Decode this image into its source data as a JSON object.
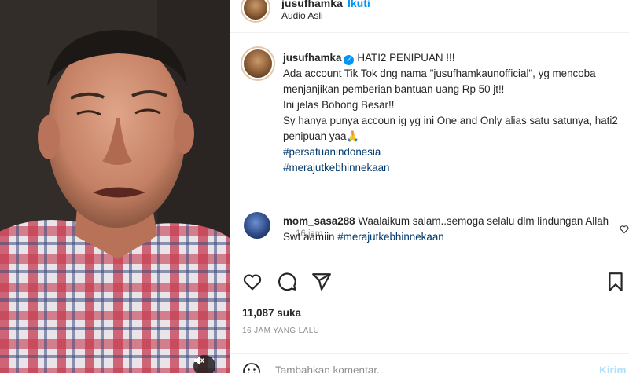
{
  "header": {
    "username": "jusufhamka",
    "follow_label": "Ikuti",
    "audio_label": "Audio Asli"
  },
  "caption": {
    "author": "jusufhamka",
    "lines": [
      "HATI2 PENIPUAN !!!",
      "Ada account Tik Tok dng nama \"jusufhamkaunofficial\", yg mencoba menjanjikan pemberian bantuan uang Rp 50 jt!!",
      "Ini jelas Bohong Besar!!",
      "Sy hanya punya accoun ig yg ini One and Only alias satu satunya, hati2 penipuan yaa🙏"
    ],
    "hashtags": [
      "#persatuanindonesia",
      "#merajutkebhinnekaan"
    ],
    "timestamp": "16 jam"
  },
  "comment": {
    "author": "mom_sasa288",
    "text": "Waalaikum salam..semoga selalu dlm lindungan Allah Swt aamiin",
    "hashtag": "#merajutkebhinnekaan"
  },
  "actions": {
    "icons": [
      "heart-icon",
      "comment-icon",
      "share-icon",
      "bookmark-icon"
    ]
  },
  "likes": "11,087 suka",
  "time_ago": "16 JAM YANG LALU",
  "add_comment": {
    "placeholder": "Tambahkan komentar...",
    "post_label": "Kirim"
  },
  "colors": {
    "link": "#0095f6",
    "hashtag": "#00376b",
    "muted": "#8e8e8e"
  }
}
